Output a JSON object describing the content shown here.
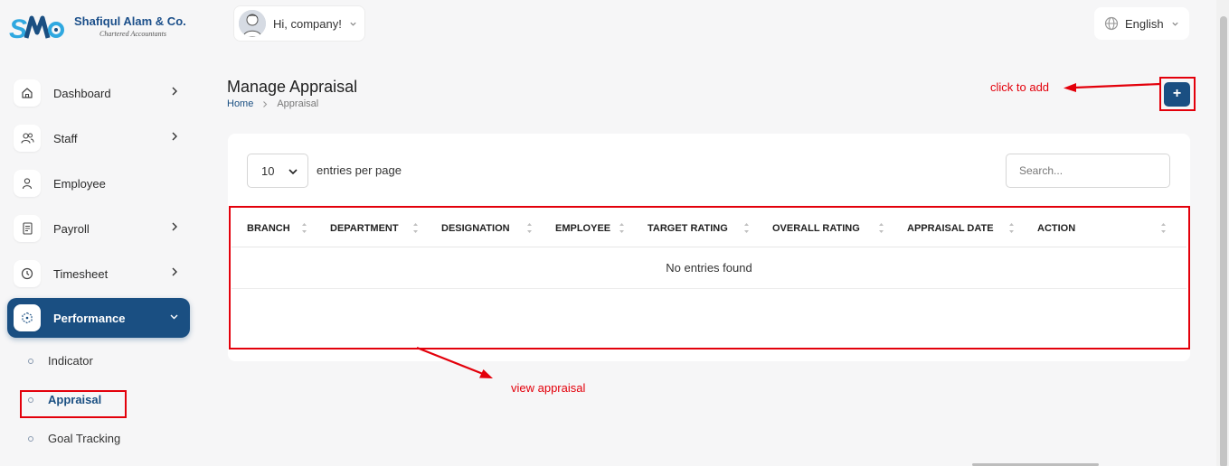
{
  "brand": {
    "name": "Shafiqul Alam & Co.",
    "tagline": "Chartered Accountants",
    "colors": {
      "primary": "#1a4f82",
      "accent": "#2fa8e0",
      "annotation": "#e3000b"
    }
  },
  "header": {
    "greeting": "Hi, company!",
    "language": "English"
  },
  "sidebar": {
    "items": [
      {
        "label": "Dashboard",
        "icon": "home-icon",
        "has_children": true
      },
      {
        "label": "Staff",
        "icon": "users-icon",
        "has_children": true
      },
      {
        "label": "Employee",
        "icon": "user-icon",
        "has_children": false
      },
      {
        "label": "Payroll",
        "icon": "receipt-icon",
        "has_children": true
      },
      {
        "label": "Timesheet",
        "icon": "clock-icon",
        "has_children": true
      },
      {
        "label": "Performance",
        "icon": "cube-icon",
        "has_children": true,
        "active": true,
        "expanded": true
      }
    ],
    "sub_items": [
      {
        "label": "Indicator"
      },
      {
        "label": "Appraisal",
        "active": true
      },
      {
        "label": "Goal Tracking"
      }
    ]
  },
  "page": {
    "title": "Manage Appraisal",
    "breadcrumb": {
      "home": "Home",
      "current": "Appraisal"
    },
    "add_button": "+"
  },
  "table": {
    "per_page_value": "10",
    "per_page_label": "entries per page",
    "search_placeholder": "Search...",
    "columns": [
      "BRANCH",
      "DEPARTMENT",
      "DESIGNATION",
      "EMPLOYEE",
      "TARGET RATING",
      "OVERALL RATING",
      "APPRAISAL DATE",
      "ACTION"
    ],
    "rows": [],
    "empty_message": "No entries found"
  },
  "annotations": {
    "add_note": "click to add",
    "view_note": "view appraisal"
  }
}
